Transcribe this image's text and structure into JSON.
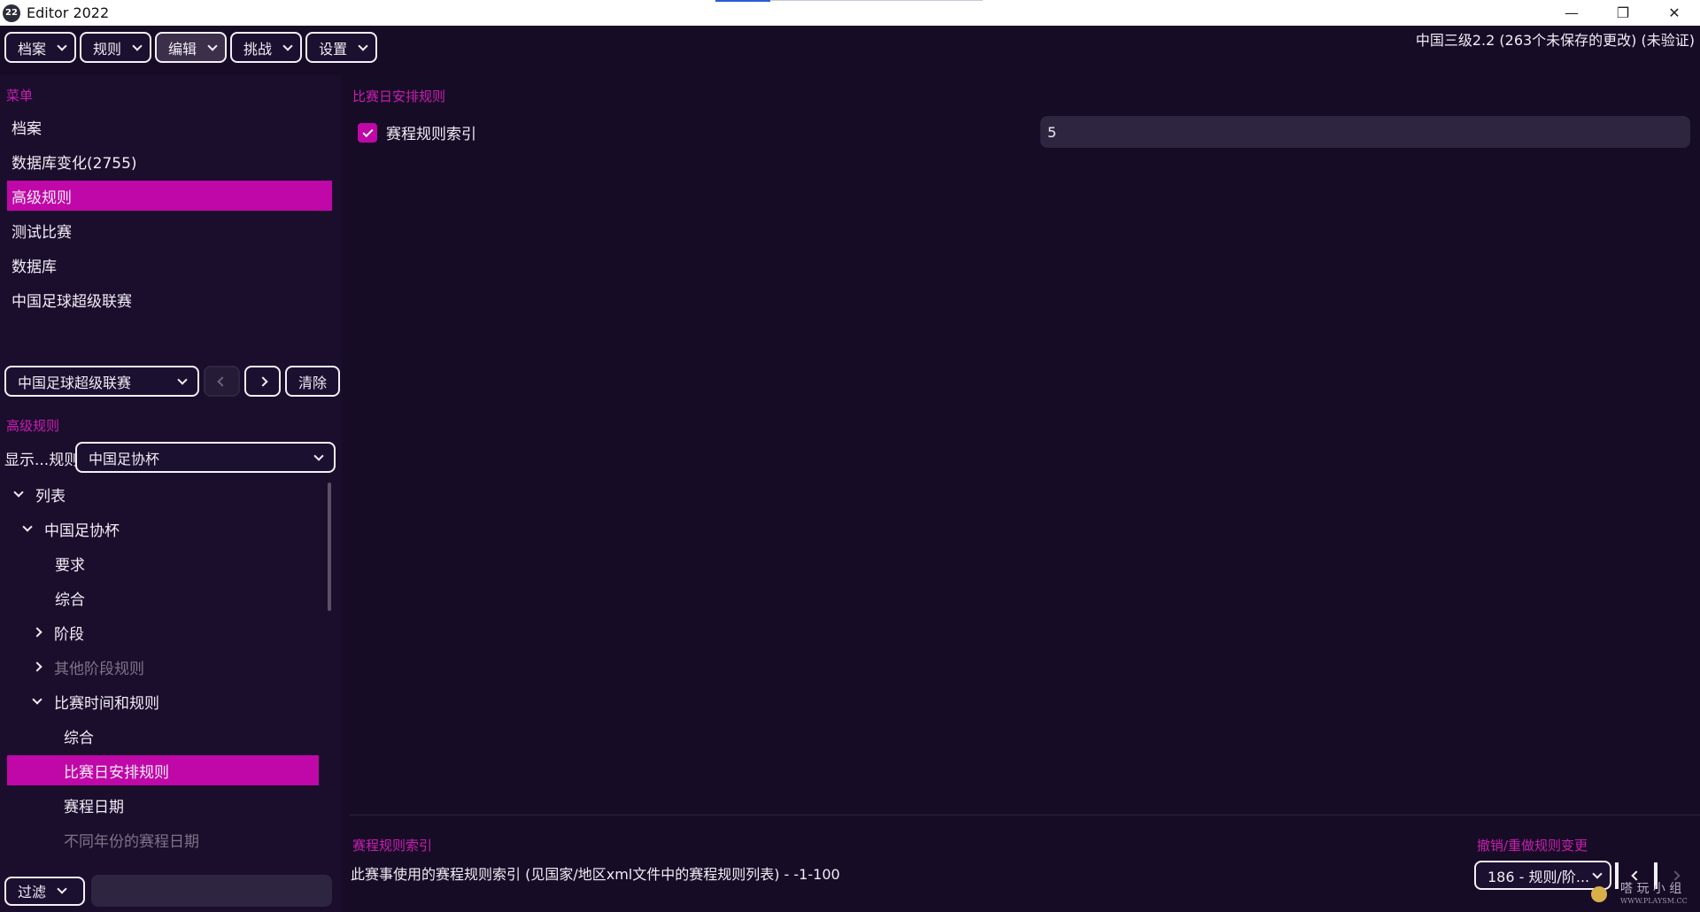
{
  "window": {
    "logo_text": "22",
    "title": "Editor 2022",
    "controls": {
      "minimize": "—",
      "maximize": "❐",
      "close": "✕"
    }
  },
  "top_menu": [
    {
      "label": "档案"
    },
    {
      "label": "规则"
    },
    {
      "label": "编辑",
      "active": true
    },
    {
      "label": "挑战"
    },
    {
      "label": "设置"
    }
  ],
  "status": "中国三级2.2 (263个未保存的更改) (未验证)",
  "menu_section": {
    "title": "菜单",
    "items": [
      {
        "label": "档案"
      },
      {
        "label": "数据库变化(2755)"
      },
      {
        "label": "高级规则",
        "selected": true
      },
      {
        "label": "测试比赛"
      },
      {
        "label": "数据库"
      },
      {
        "label": "中国足球超级联赛"
      }
    ]
  },
  "league_select": {
    "value": "中国足球超级联赛",
    "clear_label": "清除"
  },
  "rules_section": {
    "title": "高级规则",
    "show_label": "显示...规则",
    "show_value": "中国足协杯"
  },
  "tree": [
    {
      "label": "列表",
      "toggle": "down",
      "level": 0
    },
    {
      "label": "中国足协杯",
      "toggle": "down",
      "level": 1
    },
    {
      "label": "要求",
      "level": 2
    },
    {
      "label": "综合",
      "level": 2
    },
    {
      "label": "阶段",
      "toggle": "right",
      "level": 2
    },
    {
      "label": "其他阶段规则",
      "toggle": "right",
      "level": 2,
      "dim": true
    },
    {
      "label": "比赛时间和规则",
      "toggle": "down",
      "level": 2
    },
    {
      "label": "综合",
      "level": 3
    },
    {
      "label": "比赛日安排规则",
      "level": 3,
      "selected": true
    },
    {
      "label": "赛程日期",
      "level": 3
    },
    {
      "label": "不同年份的赛程日期",
      "level": 3,
      "dim": true
    }
  ],
  "filter": {
    "label": "过滤",
    "value": ""
  },
  "content": {
    "section_title": "比赛日安排规则",
    "checkbox_label": "赛程规则索引",
    "checkbox_checked": true,
    "value": "5"
  },
  "info": {
    "title": "赛程规则索引",
    "description": "此赛事使用的赛程规则索引 (见国家/地区xml文件中的赛程规则列表) - -1-100"
  },
  "undo": {
    "title": "撤销/重做规则变更",
    "select_value": "186 - 规则/阶..."
  },
  "watermark": {
    "text": "嗒 玩 小 组",
    "url": "WWW.PLAYSM.CC"
  },
  "colors": {
    "accent": "#c007a7",
    "background": "#170c26",
    "panel": "#1b0e2d"
  }
}
